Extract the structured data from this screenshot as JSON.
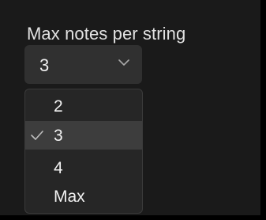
{
  "field": {
    "label": "Max notes per string",
    "selected_value": "3"
  },
  "icons": {
    "select": "chevron-down-icon",
    "selected_marker": "checkmark-icon"
  },
  "dropdown": {
    "options": [
      {
        "label": "2",
        "selected": false
      },
      {
        "label": "3",
        "selected": true
      },
      {
        "label": "4",
        "selected": false
      },
      {
        "label": "Max",
        "selected": false
      }
    ]
  },
  "colors": {
    "background": "#1a1a1a",
    "control": "#303030",
    "menu": "#262626",
    "highlight": "#3d3d3d",
    "text": "#f0f0f0"
  }
}
